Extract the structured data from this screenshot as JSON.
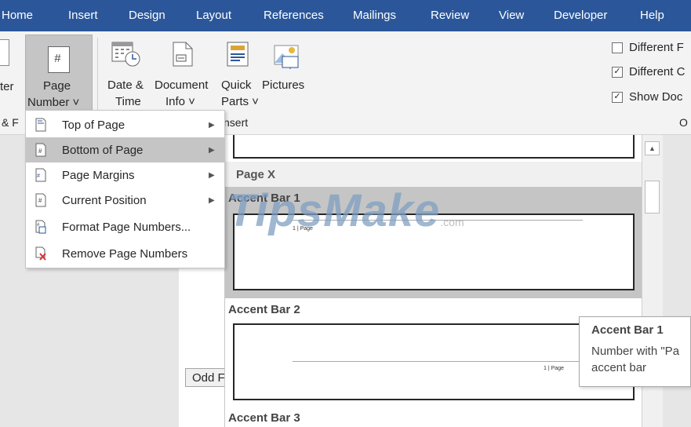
{
  "tabs": [
    "Home",
    "Insert",
    "Design",
    "Layout",
    "References",
    "Mailings",
    "Review",
    "View",
    "Developer",
    "Help"
  ],
  "ribbon": {
    "footer_partial": "ter",
    "page_number": {
      "line1": "Page",
      "line2": "Number ˅"
    },
    "date_time": {
      "line1": "Date &",
      "line2": "Time"
    },
    "document_info": {
      "line1": "Document",
      "line2": "Info ˅"
    },
    "quick_parts": {
      "line1": "Quick",
      "line2": "Parts ˅"
    },
    "pictures": {
      "line1": "Pictures"
    },
    "group_left": "& F",
    "group_insert": "nsert",
    "group_right": "O",
    "options": [
      {
        "label": "Different F",
        "checked": false
      },
      {
        "label": "Different C",
        "checked": true
      },
      {
        "label": "Show Doc",
        "checked": true
      }
    ]
  },
  "menu": {
    "items": [
      {
        "label": "Top of Page",
        "icon": "page-top-icon",
        "submenu": true,
        "selected": false
      },
      {
        "label": "Bottom of Page",
        "icon": "page-bottom-icon",
        "submenu": true,
        "selected": true
      },
      {
        "label": "Page Margins",
        "icon": "page-margins-icon",
        "submenu": true,
        "selected": false
      },
      {
        "label": "Current Position",
        "icon": "current-position-icon",
        "submenu": true,
        "selected": false
      },
      {
        "label": "Format Page Numbers...",
        "icon": "format-page-numbers-icon",
        "submenu": false,
        "selected": false
      },
      {
        "label": "Remove Page Numbers",
        "icon": "remove-page-numbers-icon",
        "submenu": false,
        "selected": false
      }
    ]
  },
  "gallery": {
    "section_header": "Page X",
    "items": [
      {
        "name": "Accent Bar 1",
        "sample": "1 | Page",
        "highlighted": true
      },
      {
        "name": "Accent Bar 2",
        "sample": "1 | Page",
        "highlighted": false
      },
      {
        "name": "Accent Bar 3",
        "highlighted": false
      }
    ]
  },
  "document": {
    "odd_footer_tab": "Odd F"
  },
  "tooltip": {
    "title": "Accent Bar 1",
    "line1": "Number with \"Pa",
    "line2": "accent bar"
  },
  "watermark": {
    "brand": "TipsMake",
    ".com": ".com"
  },
  "colors": {
    "ribbon_tabs": "#2b579a",
    "menu_selected": "#c5c5c5",
    "gallery_selected": "#c5c5c5",
    "icon_blue": "#2b579a"
  }
}
